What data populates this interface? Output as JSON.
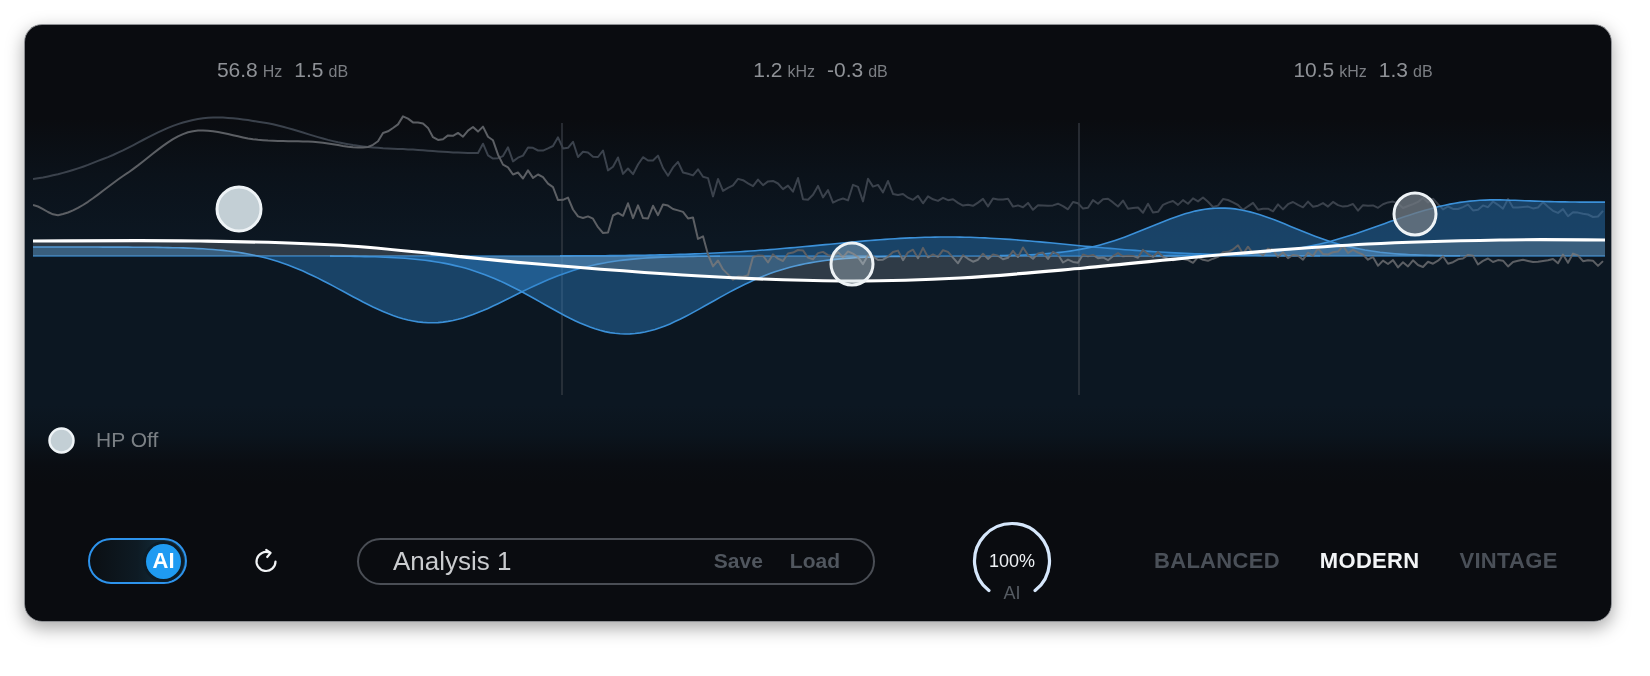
{
  "bands": [
    {
      "frequency": "56.8",
      "frequency_unit": "Hz",
      "gain": "1.5",
      "gain_unit": "dB"
    },
    {
      "frequency": "1.2",
      "frequency_unit": "kHz",
      "gain": "-0.3",
      "gain_unit": "dB"
    },
    {
      "frequency": "10.5",
      "frequency_unit": "kHz",
      "gain": "1.3",
      "gain_unit": "dB"
    }
  ],
  "high_pass": {
    "label": "HP Off"
  },
  "ai_toggle": {
    "label": "AI",
    "on": true
  },
  "preset": {
    "name": "Analysis 1",
    "actions": [
      {
        "label": "Save"
      },
      {
        "label": "Load"
      }
    ]
  },
  "ai_amount": {
    "reading": "100%",
    "label": "AI",
    "level": 1
  },
  "modes": [
    {
      "label": "BALANCED",
      "selected": false
    },
    {
      "label": "MODERN",
      "selected": true
    },
    {
      "label": "VINTAGE",
      "selected": false
    }
  ]
}
